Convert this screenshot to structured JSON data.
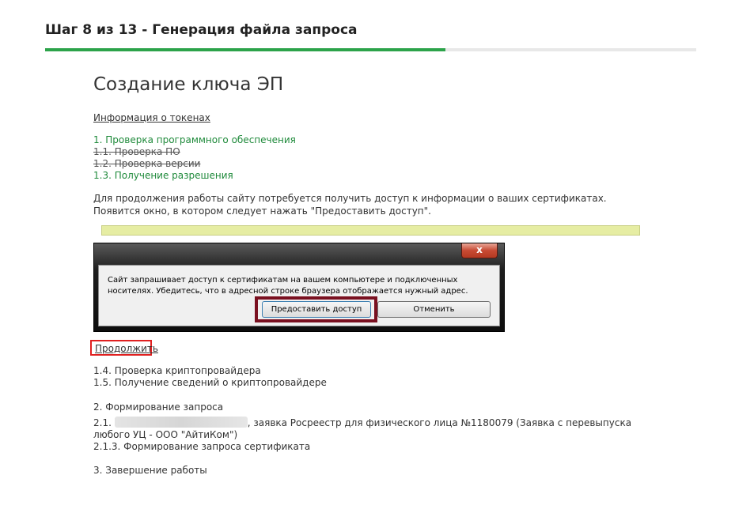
{
  "header": {
    "step_title": "Шаг 8 из 13 - Генерация файла запроса",
    "progress_fraction": 0.615
  },
  "main": {
    "title": "Создание ключа ЭП",
    "tokens_link": "Информация о токенах",
    "steps": [
      {
        "label": "1. Проверка программного обеспечения",
        "state": "active"
      },
      {
        "label": "1.1. Проверка ПО",
        "state": "done"
      },
      {
        "label": "1.2. Проверка версии",
        "state": "done"
      },
      {
        "label": "1.3. Получение разрешения",
        "state": "active"
      }
    ],
    "info_text": "Для продолжения работы сайту потребуется получить доступ к информации о ваших сертификатах. Появится окно, в котором следует нажать \"Предоставить доступ\".",
    "colors": {
      "accent_green": "#2ca34a",
      "step_green": "#1f8a3b",
      "highlight_red": "#e02020",
      "dialog_highlight": "#7a1020",
      "yellow_bar": "#e6eda3"
    }
  },
  "dialog": {
    "close_icon": "close-icon",
    "close_glyph": "x",
    "message": "Сайт запрашивает доступ к сертификатам на вашем компьютере и подключенных носителях. Убедитесь, что в адресной строке браузера отображается нужный адрес.",
    "grant_label": "Предоставить доступ",
    "cancel_label": "Отменить"
  },
  "continue_link": "Продолжить",
  "lower": {
    "steps": [
      "1.4. Проверка криптопровайдера",
      "1.5. Получение сведений о криптопровайдере"
    ],
    "section2": "2. Формирование запроса",
    "app_prefix": "2.1.",
    "app_suffix": ", заявка Росреестр для физического лица №1180079 (Заявка с перевыпуска любого УЦ - ООО \"АйтиКом\")",
    "sub_step": "2.1.3. Формирование запроса сертификата",
    "section3": "3. Завершение работы"
  }
}
